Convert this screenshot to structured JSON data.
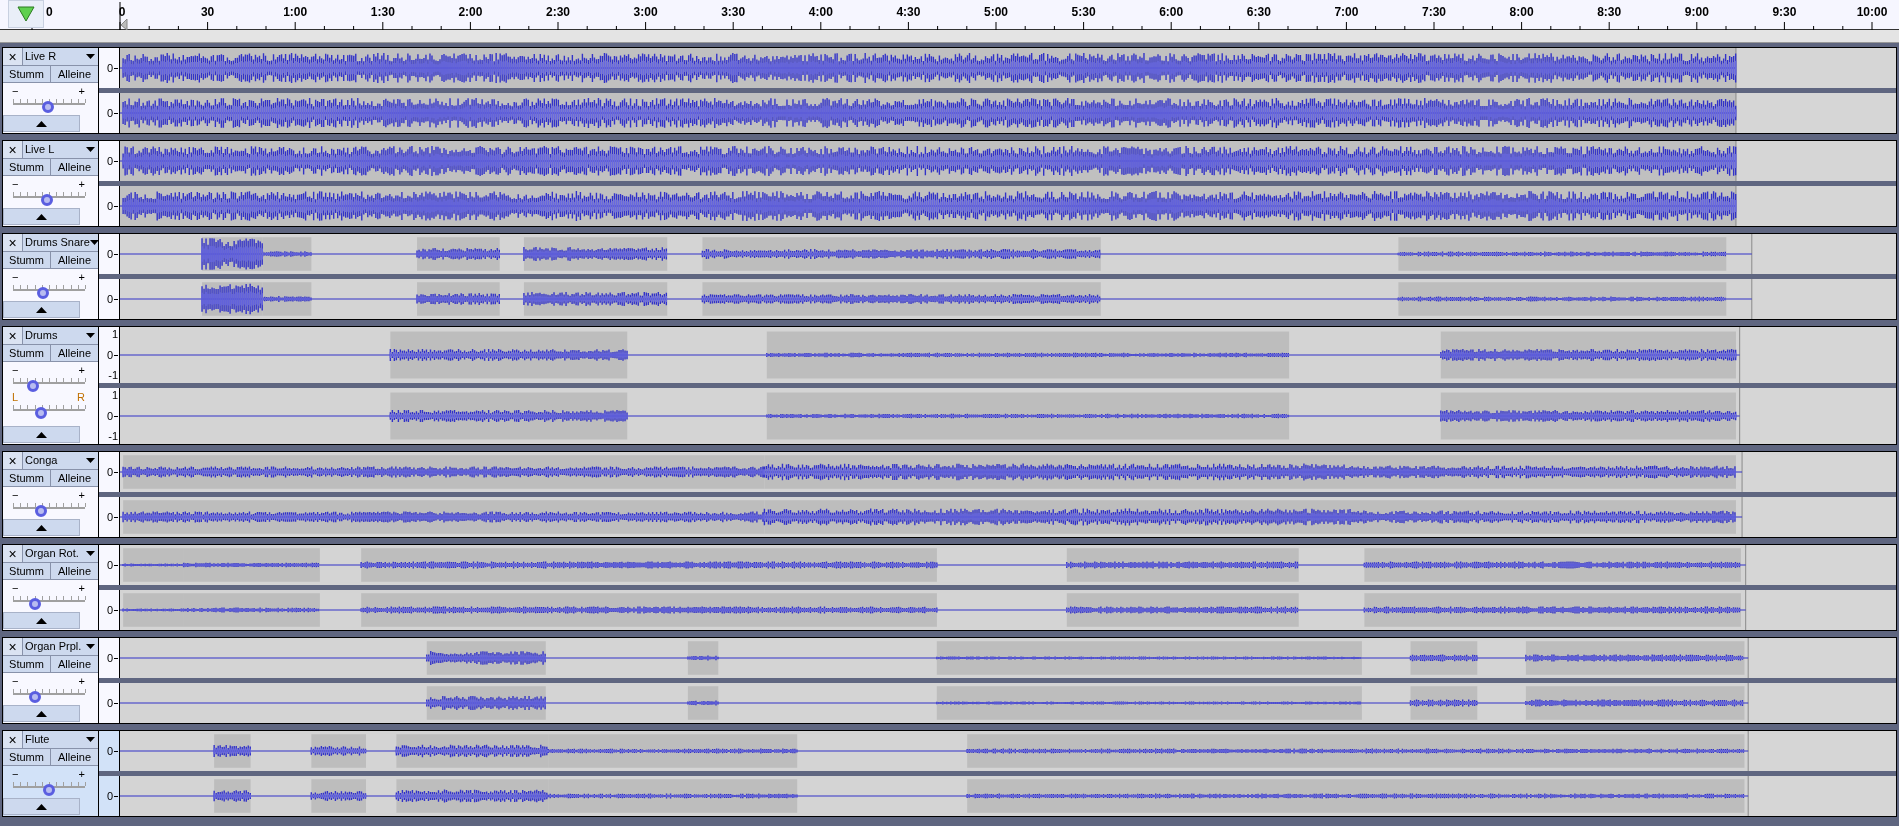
{
  "ruler": {
    "labels": [
      "0",
      "0",
      "30",
      "1:00",
      "1:30",
      "2:00",
      "2:30",
      "3:00",
      "3:30",
      "4:00",
      "4:30",
      "5:00",
      "5:30",
      "6:00",
      "6:30",
      "7:00",
      "7:30",
      "8:00",
      "8:30",
      "9:00",
      "9:30",
      "10:00"
    ]
  },
  "tracks": [
    {
      "name": "Live R",
      "selected": false,
      "close": "×",
      "buttons": [
        "Stumm",
        "Alleine"
      ],
      "gain_slider": {
        "labels": [
          "−",
          "+"
        ],
        "level": 0.48
      },
      "channels": [
        {
          "scale": [
            "0"
          ]
        },
        {
          "scale": [
            "0"
          ]
        }
      ]
    },
    {
      "name": "Live L",
      "selected": false,
      "close": "×",
      "buttons": [
        "Stumm",
        "Alleine"
      ],
      "gain_slider": {
        "labels": [
          "−",
          "+"
        ],
        "level": 0.47
      },
      "channels": [
        {
          "scale": [
            "0"
          ]
        },
        {
          "scale": [
            "0"
          ]
        }
      ]
    },
    {
      "name": "Drums Snare",
      "selected": false,
      "close": "×",
      "buttons": [
        "Stumm",
        "Alleine"
      ],
      "gain_slider": {
        "labels": [
          "−",
          "+"
        ],
        "level": 0.42
      },
      "channels": [
        {
          "scale": [
            "0"
          ]
        },
        {
          "scale": [
            "0"
          ]
        }
      ]
    },
    {
      "name": "Drums",
      "selected": false,
      "close": "×",
      "buttons": [
        "Stumm",
        "Alleine"
      ],
      "gain_slider": {
        "labels": [
          "−",
          "+"
        ],
        "level": 0.28
      },
      "pan_slider": {
        "labels": [
          "L",
          "R"
        ],
        "level": 0.39
      },
      "channels": [
        {
          "scale": [
            "1",
            "0",
            "-1"
          ]
        },
        {
          "scale": [
            "1",
            "0",
            "-1"
          ]
        }
      ]
    },
    {
      "name": "Conga",
      "selected": false,
      "close": "×",
      "buttons": [
        "Stumm",
        "Alleine"
      ],
      "gain_slider": {
        "labels": [
          "−",
          "+"
        ],
        "level": 0.39
      },
      "channels": [
        {
          "scale": [
            "0"
          ]
        },
        {
          "scale": [
            "0"
          ]
        }
      ]
    },
    {
      "name": "Organ Rot.",
      "selected": false,
      "close": "×",
      "buttons": [
        "Stumm",
        "Alleine"
      ],
      "gain_slider": {
        "labels": [
          "−",
          "+"
        ],
        "level": 0.31
      },
      "channels": [
        {
          "scale": [
            "0"
          ]
        },
        {
          "scale": [
            "0"
          ]
        }
      ]
    },
    {
      "name": "Organ Prpl.",
      "selected": false,
      "close": "×",
      "buttons": [
        "Stumm",
        "Alleine"
      ],
      "gain_slider": {
        "labels": [
          "−",
          "+"
        ],
        "level": 0.31
      },
      "channels": [
        {
          "scale": [
            "0"
          ]
        },
        {
          "scale": [
            "0"
          ]
        }
      ]
    },
    {
      "name": "Flute",
      "selected": true,
      "close": "×",
      "buttons": [
        "Stumm",
        "Alleine"
      ],
      "gain_slider": {
        "labels": [
          "−",
          "+"
        ],
        "level": 0.5
      },
      "channels": [
        {
          "scale": [
            "0"
          ]
        },
        {
          "scale": [
            "0"
          ]
        }
      ]
    }
  ]
}
